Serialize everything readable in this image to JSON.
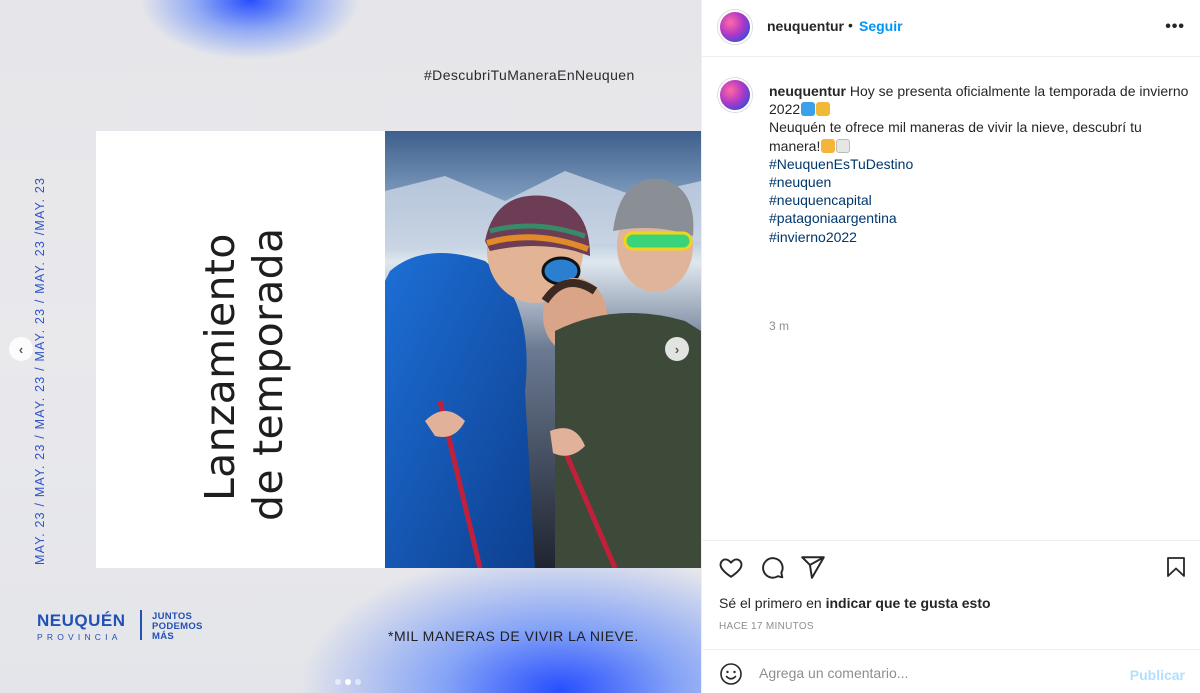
{
  "post": {
    "hashtag_banner": "#DescubriTuManeraEnNeuquen",
    "date_strip": "MAY. 23 / MAY. 23 / MAY. 23 / MAY. 23 / MAY. 23 /MAY. 23",
    "title_line1": "Lanzamiento",
    "title_line2": "de temporada",
    "logo_main": "NEUQUÉN",
    "logo_sub": "PROVINCIA",
    "logo_juntos": [
      "JUNTOS",
      "PODEMOS",
      "MÁS"
    ],
    "tagline": "*MIL MANERAS DE VIVIR LA NIEVE.",
    "carousel_dots": 3,
    "carousel_active": 2
  },
  "header": {
    "username": "neuquentur",
    "dot": "•",
    "follow_label": "Seguir",
    "more_icon": "more-horizontal-icon"
  },
  "caption": {
    "username": "neuquentur",
    "text_line1": "Hoy se presenta oficialmente la temporada de invierno 2022",
    "text_line2": "Neuquén te ofrece mil maneras de vivir la nieve, descubrí tu manera!",
    "hashtags": [
      "#NeuquenEsTuDestino",
      "#neuquen",
      "#neuquencapital",
      "#patagoniaargentina",
      "#invierno2022"
    ],
    "relative_time": "3 m"
  },
  "actions": {
    "like_icon": "heart-icon",
    "comment_icon": "comment-icon",
    "share_icon": "send-icon",
    "save_icon": "bookmark-icon"
  },
  "likes": {
    "prefix": "Sé el primero en",
    "link": "indicar que te gusta esto"
  },
  "timestamp": "HACE 17 MINUTOS",
  "comment": {
    "emoji_icon": "smiley-icon",
    "placeholder": "Agrega un comentario...",
    "publish_label": "Publicar"
  },
  "colors": {
    "accent_blue": "#0095f6",
    "hashtag_blue": "#00376b",
    "brand_blue": "#2350b4",
    "publish_disabled": "#b3dffc"
  }
}
